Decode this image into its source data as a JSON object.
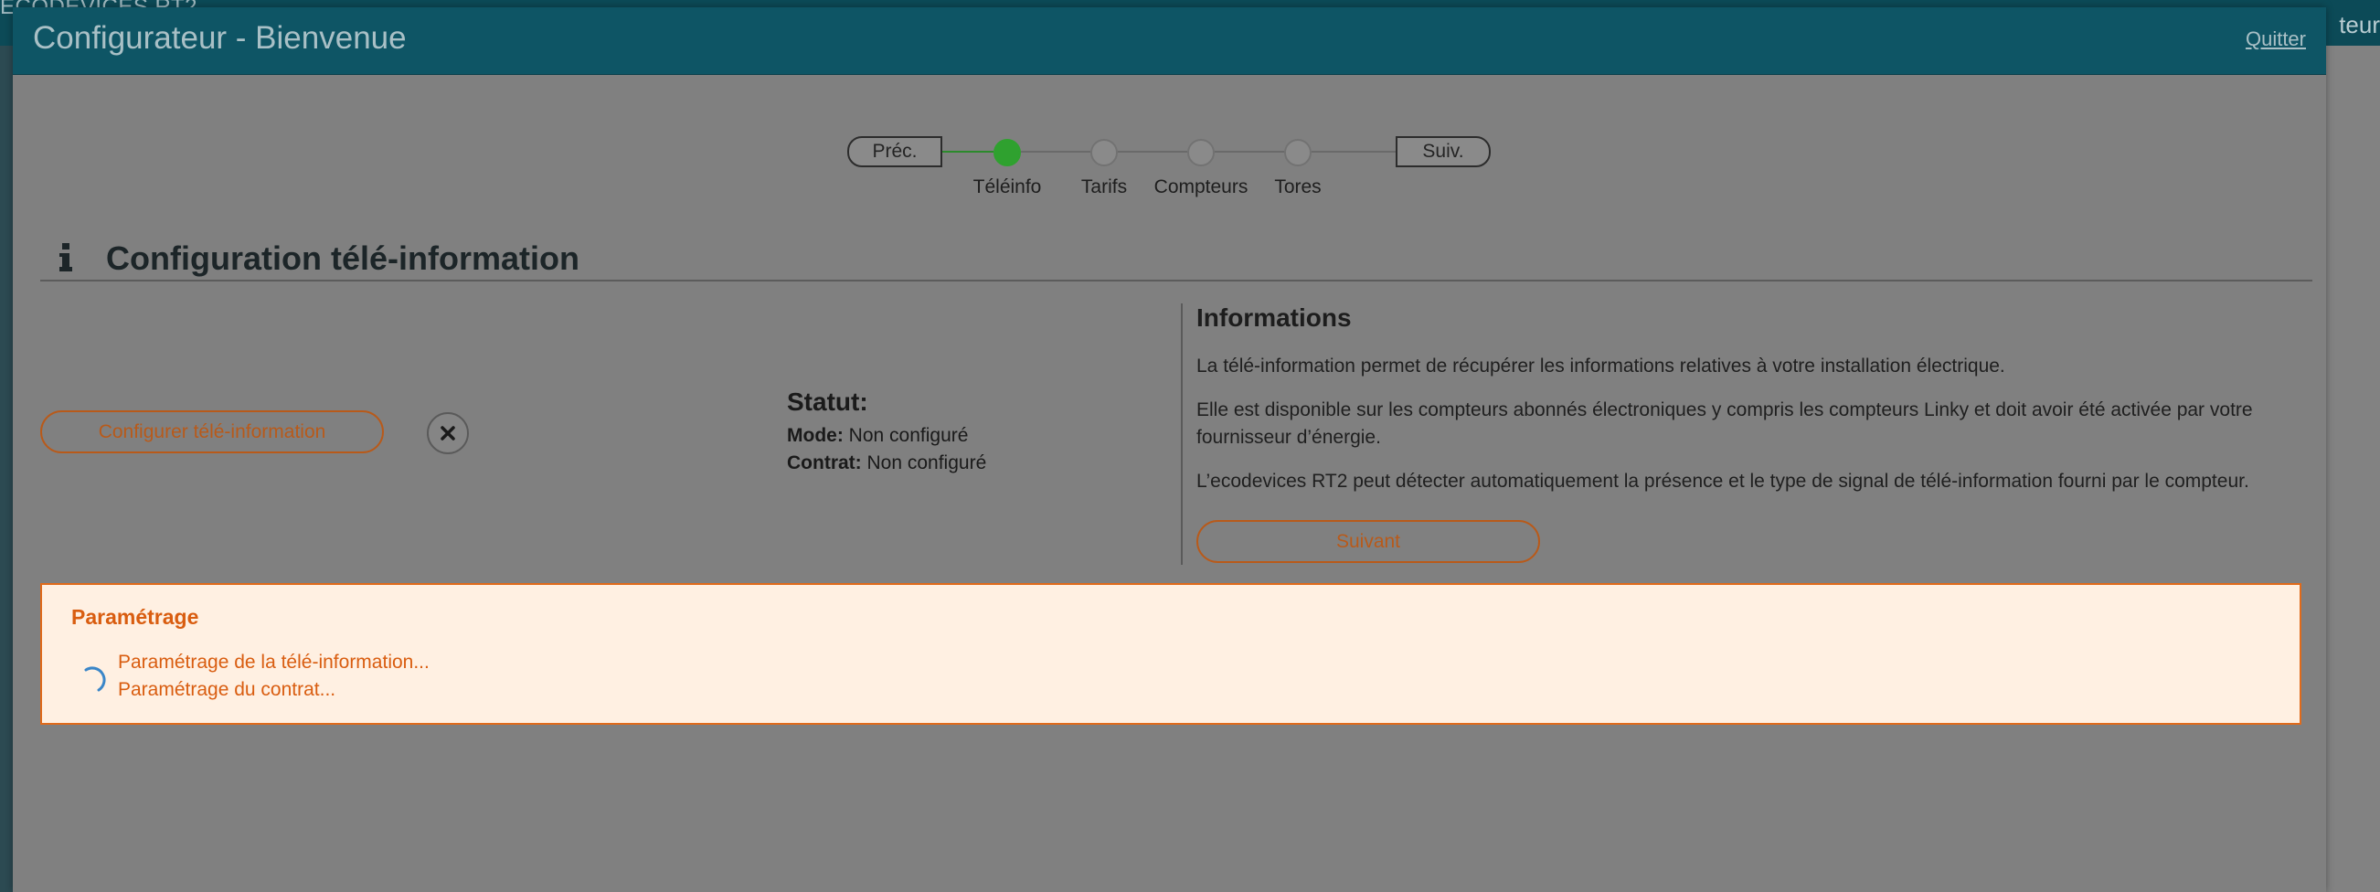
{
  "background": {
    "brand": "ECODEVICES RT2",
    "right_text": "teur"
  },
  "modal": {
    "title": "Configurateur - Bienvenue",
    "quit_label": "Quitter"
  },
  "stepper": {
    "prev_label": "Préc.",
    "next_label": "Suiv.",
    "steps": [
      {
        "label": "Téléinfo",
        "state": "active"
      },
      {
        "label": "Tarifs",
        "state": "pending"
      },
      {
        "label": "Compteurs",
        "state": "pending"
      },
      {
        "label": "Tores",
        "state": "pending"
      }
    ]
  },
  "section": {
    "icon": "info-icon",
    "title": "Configuration télé-information"
  },
  "actions": {
    "configure_label": "Configurer télé-information",
    "close_icon": "close-icon"
  },
  "status": {
    "title": "Statut:",
    "mode_label": "Mode:",
    "mode_value": "Non configuré",
    "contract_label": "Contrat:",
    "contract_value": "Non configuré"
  },
  "informations": {
    "title": "Informations",
    "p1": "La télé-information permet de récupérer les informations relatives à votre installation électrique.",
    "p2": "Elle est disponible sur les compteurs abonnés électroniques y compris les compteurs Linky et doit avoir été activée par votre fournisseur d’énergie.",
    "p3": "L’ecodevices RT2 peut détecter automatiquement la présence et le type de signal de télé-information fourni par le compteur.",
    "next_label": "Suivant"
  },
  "parametrage": {
    "title": "Paramétrage",
    "lines": [
      "Paramétrage de la télé-information...",
      "Paramétrage du contrat..."
    ]
  },
  "colors": {
    "header": "#0e5565",
    "accent_orange": "#d95d10",
    "active_step": "#2fa12f"
  }
}
